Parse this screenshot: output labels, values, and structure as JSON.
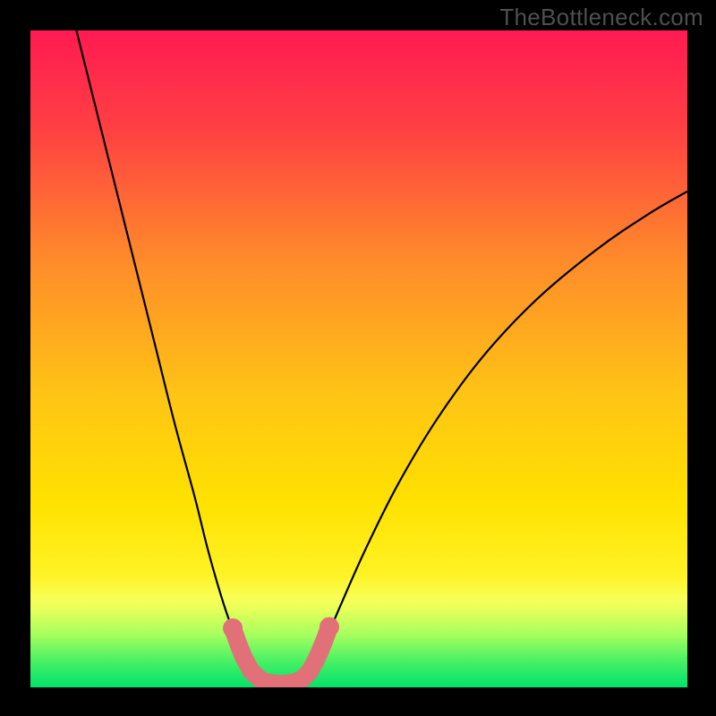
{
  "watermark": "TheBottleneck.com",
  "chart_data": {
    "type": "line",
    "title": "",
    "xlabel": "",
    "ylabel": "",
    "xlim": [
      0,
      1
    ],
    "ylim": [
      0,
      1
    ],
    "background_gradient": {
      "top": "#ff1a52",
      "mid": "#ffd000",
      "green_band_top": "#f8ff57",
      "green_band_bottom": "#00e26a"
    },
    "series": [
      {
        "name": "curve",
        "stroke": "#000000",
        "points": [
          {
            "x": 0.07,
            "y": 1.0
          },
          {
            "x": 0.1,
            "y": 0.88
          },
          {
            "x": 0.13,
            "y": 0.76
          },
          {
            "x": 0.16,
            "y": 0.64
          },
          {
            "x": 0.19,
            "y": 0.52
          },
          {
            "x": 0.22,
            "y": 0.4
          },
          {
            "x": 0.25,
            "y": 0.29
          },
          {
            "x": 0.27,
            "y": 0.21
          },
          {
            "x": 0.29,
            "y": 0.14
          },
          {
            "x": 0.305,
            "y": 0.095
          },
          {
            "x": 0.32,
            "y": 0.055
          },
          {
            "x": 0.335,
            "y": 0.028
          },
          {
            "x": 0.35,
            "y": 0.012
          },
          {
            "x": 0.365,
            "y": 0.006
          },
          {
            "x": 0.38,
            "y": 0.005
          },
          {
            "x": 0.395,
            "y": 0.005
          },
          {
            "x": 0.41,
            "y": 0.009
          },
          {
            "x": 0.425,
            "y": 0.024
          },
          {
            "x": 0.44,
            "y": 0.05
          },
          {
            "x": 0.47,
            "y": 0.12
          },
          {
            "x": 0.51,
            "y": 0.21
          },
          {
            "x": 0.56,
            "y": 0.31
          },
          {
            "x": 0.62,
            "y": 0.41
          },
          {
            "x": 0.69,
            "y": 0.505
          },
          {
            "x": 0.77,
            "y": 0.59
          },
          {
            "x": 0.86,
            "y": 0.665
          },
          {
            "x": 0.94,
            "y": 0.72
          },
          {
            "x": 1.0,
            "y": 0.755
          }
        ]
      },
      {
        "name": "markers",
        "stroke": "#e17079",
        "fill": "#e17079",
        "points": [
          {
            "x": 0.308,
            "y": 0.09
          },
          {
            "x": 0.318,
            "y": 0.062
          },
          {
            "x": 0.325,
            "y": 0.045
          },
          {
            "x": 0.336,
            "y": 0.025
          },
          {
            "x": 0.352,
            "y": 0.01
          },
          {
            "x": 0.368,
            "y": 0.006
          },
          {
            "x": 0.384,
            "y": 0.005
          },
          {
            "x": 0.4,
            "y": 0.007
          },
          {
            "x": 0.413,
            "y": 0.012
          },
          {
            "x": 0.425,
            "y": 0.024
          },
          {
            "x": 0.434,
            "y": 0.04
          },
          {
            "x": 0.442,
            "y": 0.058
          },
          {
            "x": 0.448,
            "y": 0.073
          },
          {
            "x": 0.455,
            "y": 0.092
          }
        ]
      }
    ]
  }
}
